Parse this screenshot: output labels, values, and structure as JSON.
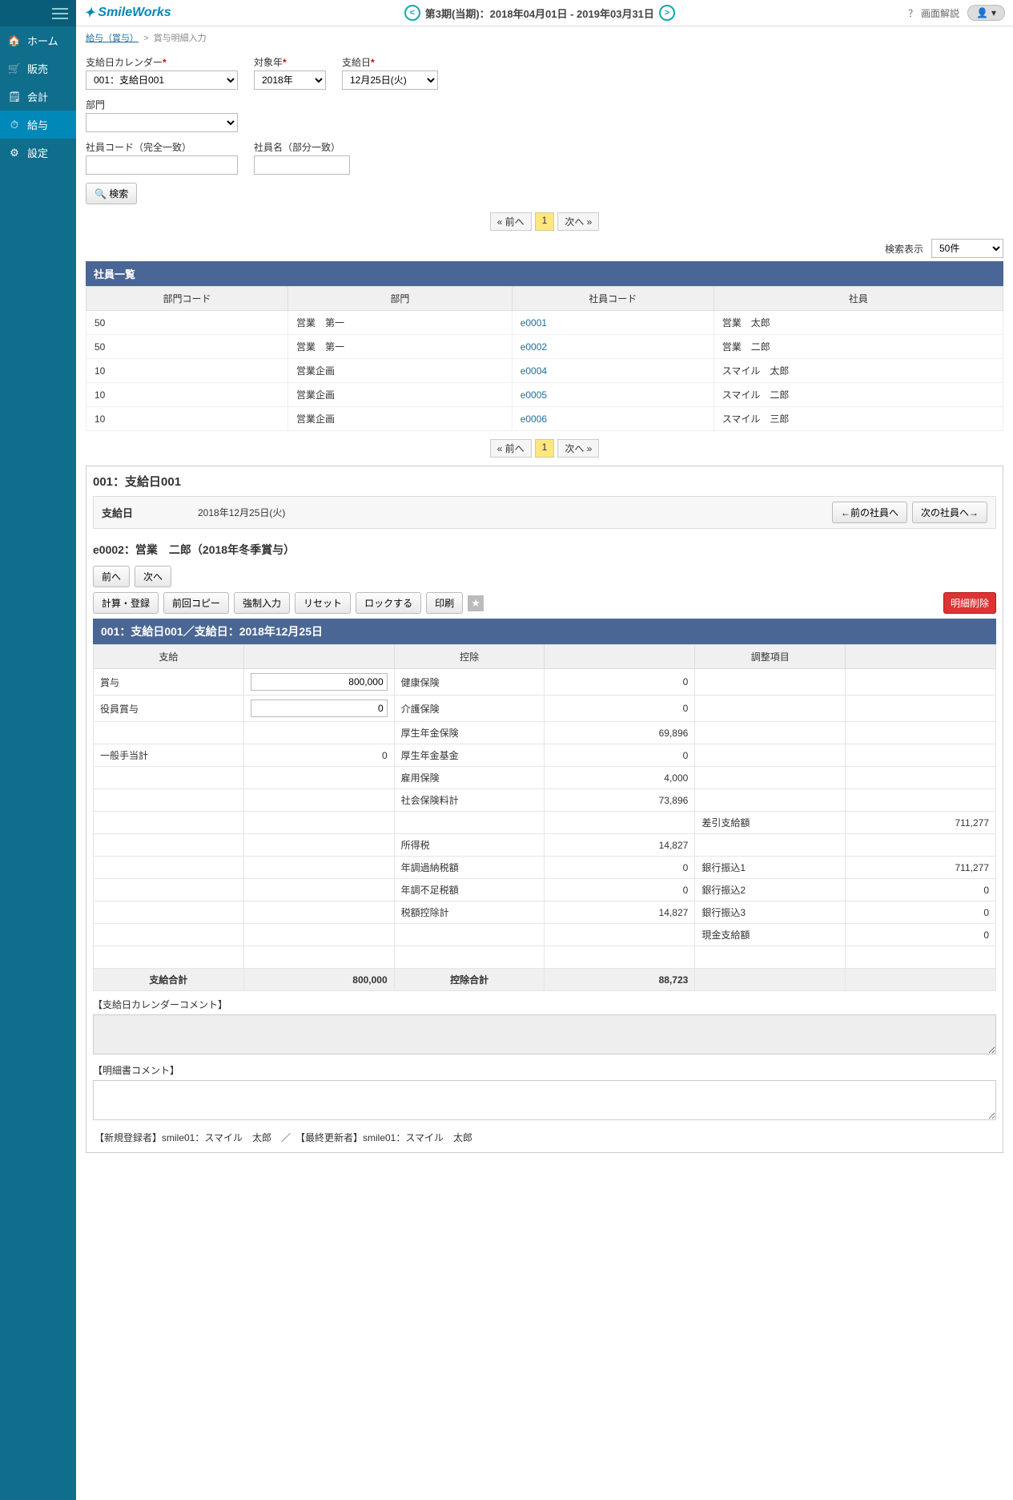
{
  "sidebar": {
    "items": [
      {
        "label": "ホーム",
        "icon": "home"
      },
      {
        "label": "販売",
        "icon": "cart"
      },
      {
        "label": "会計",
        "icon": "calc"
      },
      {
        "label": "給与",
        "icon": "clock",
        "active": true
      },
      {
        "label": "設定",
        "icon": "gear"
      }
    ]
  },
  "header": {
    "logo": "SmileWorks",
    "period": "第3期(当期)：2018年04月01日 - 2019年03月31日",
    "help": "画面解説"
  },
  "breadcrumb": {
    "a": "給与（賞与）",
    "b": "賞与明細入力"
  },
  "filters": {
    "calendar_label": "支給日カレンダー",
    "calendar_value": "001：支給日001",
    "year_label": "対象年",
    "year_value": "2018年",
    "paydate_label": "支給日",
    "paydate_value": "12月25日(火)",
    "dept_label": "部門",
    "dept_value": "",
    "empcode_label": "社員コード（完全一致）",
    "empname_label": "社員名（部分一致）",
    "search": "検索"
  },
  "pager": {
    "prev": "« 前へ",
    "page": "1",
    "next": "次へ »"
  },
  "result_opts": {
    "label": "検索表示",
    "value": "50件"
  },
  "emp_list": {
    "title": "社員一覧",
    "headers": [
      "部門コード",
      "部門",
      "社員コード",
      "社員"
    ],
    "rows": [
      [
        "50",
        "営業　第一",
        "e0001",
        "営業　太郎"
      ],
      [
        "50",
        "営業　第一",
        "e0002",
        "営業　二郎"
      ],
      [
        "10",
        "営業企画",
        "e0004",
        "スマイル　太郎"
      ],
      [
        "10",
        "営業企画",
        "e0005",
        "スマイル　二郎"
      ],
      [
        "10",
        "営業企画",
        "e0006",
        "スマイル　三郎"
      ]
    ]
  },
  "detail": {
    "title": "001：支給日001",
    "paydate_label": "支給日",
    "paydate_value": "2018年12月25日(火)",
    "prev_emp": "←前の社員へ",
    "next_emp": "次の社員へ→",
    "emp_title": "e0002：営業　二郎（2018年冬季賞与）",
    "nav_prev": "前へ",
    "nav_next": "次へ",
    "actions": {
      "calc": "計算・登録",
      "copy": "前回コピー",
      "force": "強制入力",
      "reset": "リセット",
      "lock": "ロックする",
      "print": "印刷",
      "delete": "明細削除"
    },
    "bluebar": "001：支給日001／支給日：2018年12月25日",
    "calc_headers": [
      "支給",
      "",
      "控除",
      "",
      "調整項目",
      ""
    ],
    "pay_rows": [
      {
        "label": "賞与",
        "input": "800,000"
      },
      {
        "label": "役員賞与",
        "input": "0"
      },
      {
        "label": "",
        "value": ""
      },
      {
        "label": "一般手当計",
        "value": "0"
      }
    ],
    "ded_rows": [
      {
        "label": "健康保険",
        "value": "0"
      },
      {
        "label": "介護保険",
        "value": "0"
      },
      {
        "label": "厚生年金保険",
        "value": "69,896"
      },
      {
        "label": "厚生年金基金",
        "value": "0"
      },
      {
        "label": "雇用保険",
        "value": "4,000"
      },
      {
        "label": "社会保険料計",
        "value": "73,896"
      },
      {
        "label": "",
        "value": ""
      },
      {
        "label": "所得税",
        "value": "14,827"
      },
      {
        "label": "年調過納税額",
        "value": "0"
      },
      {
        "label": "年調不足税額",
        "value": "0"
      },
      {
        "label": "税額控除計",
        "value": "14,827"
      }
    ],
    "adj_rows": [
      {
        "label": "差引支給額",
        "value": "711,277"
      },
      {
        "label": "銀行振込1",
        "value": "711,277"
      },
      {
        "label": "銀行振込2",
        "value": "0"
      },
      {
        "label": "銀行振込3",
        "value": "0"
      },
      {
        "label": "現金支給額",
        "value": "0"
      }
    ],
    "totals": {
      "pay_label": "支給合計",
      "pay": "800,000",
      "ded_label": "控除合計",
      "ded": "88,723"
    },
    "comment1_label": "【支給日カレンダーコメント】",
    "comment2_label": "【明細書コメント】",
    "audit": "【新規登録者】smile01：スマイル　太郎　／　【最終更新者】smile01：スマイル　太郎"
  }
}
